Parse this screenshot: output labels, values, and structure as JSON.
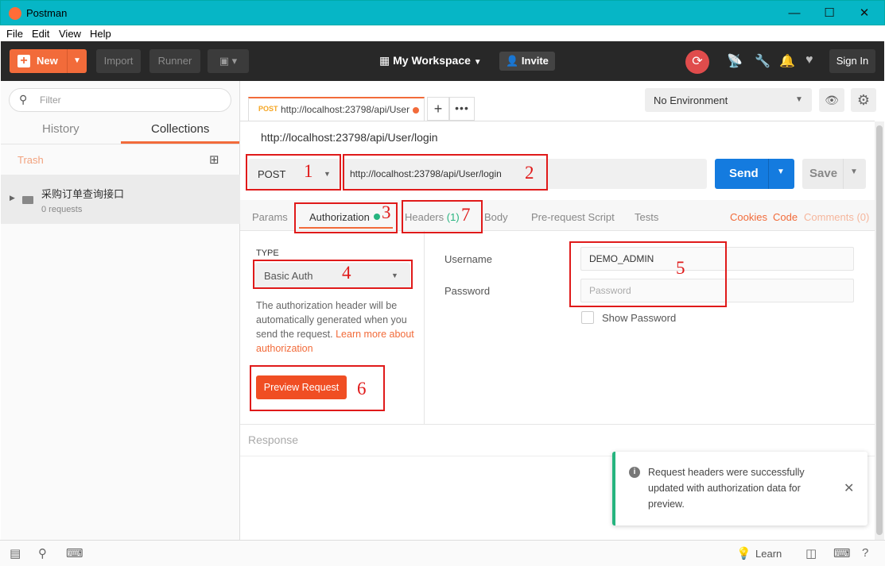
{
  "window": {
    "title": "Postman",
    "minimize": "—",
    "maximize": "☐",
    "close": "✕"
  },
  "menu": [
    "File",
    "Edit",
    "View",
    "Help"
  ],
  "toolbar": {
    "new_label": "New",
    "import_label": "Import",
    "runner_label": "Runner",
    "workspace_label": "My Workspace",
    "invite_label": "Invite",
    "signin_label": "Sign In"
  },
  "sidebar": {
    "filter_placeholder": "Filter",
    "tabs": [
      "History",
      "Collections"
    ],
    "trash_label": "Trash",
    "collection": {
      "name": "采购订单查询接口",
      "count": "0 requests"
    }
  },
  "request_tab": {
    "method": "POST",
    "url": "http://localhost:23798/api/User"
  },
  "environment": "No Environment",
  "request": {
    "title": "http://localhost:23798/api/User/login",
    "method": "POST",
    "url": "http://localhost:23798/api/User/login",
    "send_label": "Send",
    "save_label": "Save"
  },
  "subtabs": {
    "params": "Params",
    "authorization": "Authorization",
    "headers": "Headers",
    "headers_count": "(1)",
    "body": "Body",
    "prerequest": "Pre-request Script",
    "tests": "Tests",
    "cookies": "Cookies",
    "code": "Code",
    "comments": "Comments (0)"
  },
  "auth": {
    "type_label": "TYPE",
    "type_value": "Basic Auth",
    "desc": "The authorization header will be automatically generated when you send the request.",
    "learn_more": "Learn more about authorization",
    "preview_label": "Preview Request",
    "username_label": "Username",
    "username_value": "DEMO_ADMIN",
    "password_label": "Password",
    "password_placeholder": "Password",
    "show_password_label": "Show Password"
  },
  "response_label": "Response",
  "toast": {
    "message": "Request headers were successfully updated with authorization data for preview."
  },
  "status": {
    "learn_label": "Learn"
  },
  "annotations": [
    "1",
    "2",
    "3",
    "4",
    "5",
    "6",
    "7"
  ],
  "colors": {
    "accent": "#f26b3a",
    "send": "#147bdf",
    "titlebar": "#06b6c6",
    "toolbar": "#282828",
    "annotation": "#e01a1a",
    "success": "#26b47f"
  }
}
